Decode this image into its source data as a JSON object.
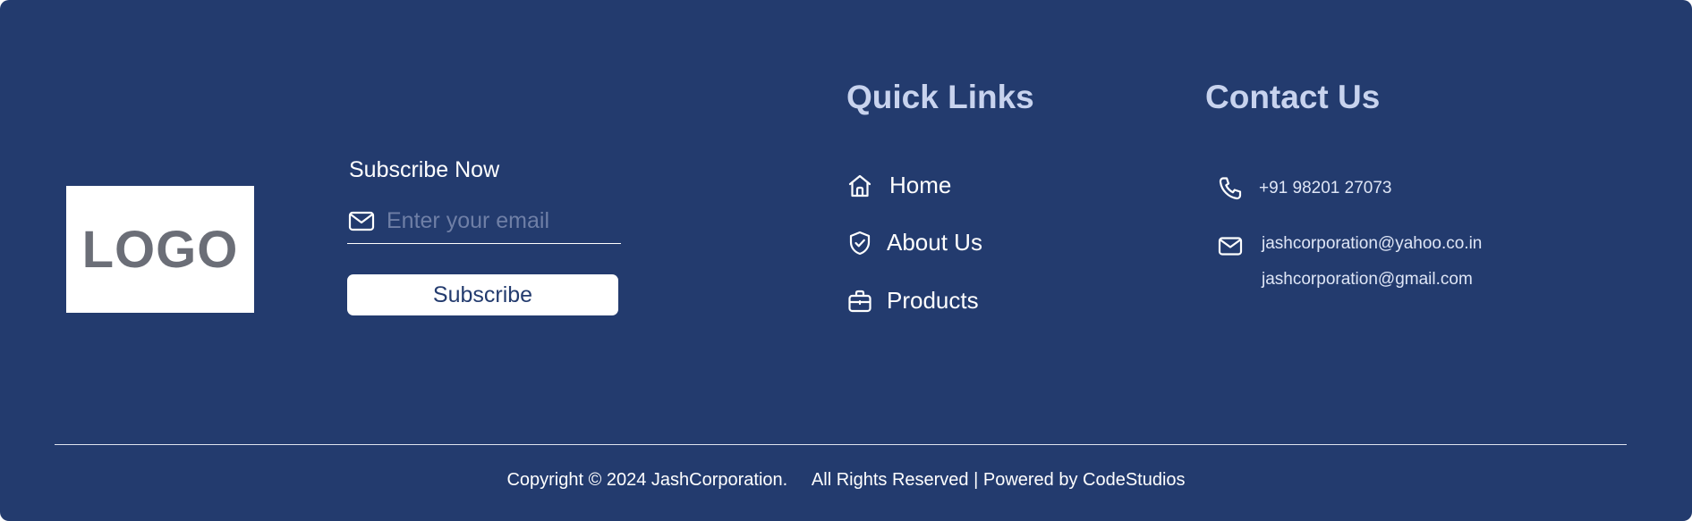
{
  "logo": {
    "text": "LOGO"
  },
  "subscribe": {
    "title": "Subscribe Now",
    "email_placeholder": "Enter your email",
    "email_value": "",
    "button_label": "Subscribe",
    "email_icon": "envelope-icon"
  },
  "quick_links": {
    "heading": "Quick Links",
    "items": [
      {
        "label": "Home",
        "icon": "home-icon"
      },
      {
        "label": "About Us",
        "icon": "shield-check-icon"
      },
      {
        "label": "Products",
        "icon": "briefcase-icon"
      }
    ]
  },
  "contact": {
    "heading": "Contact Us",
    "phone": "+91 98201 27073",
    "emails": [
      "jashcorporation@yahoo.co.in",
      "jashcorporation@gmail.com"
    ],
    "phone_icon": "phone-icon",
    "email_icon": "envelope-icon"
  },
  "footer": {
    "copyright": "Copyright © 2024 JashCorporation.     All Rights Reserved | Powered by CodeStudios"
  },
  "colors": {
    "background": "#233b6e",
    "heading": "#c8d3ee",
    "logo_text": "#6b6e77",
    "button_text": "#233b6e"
  }
}
